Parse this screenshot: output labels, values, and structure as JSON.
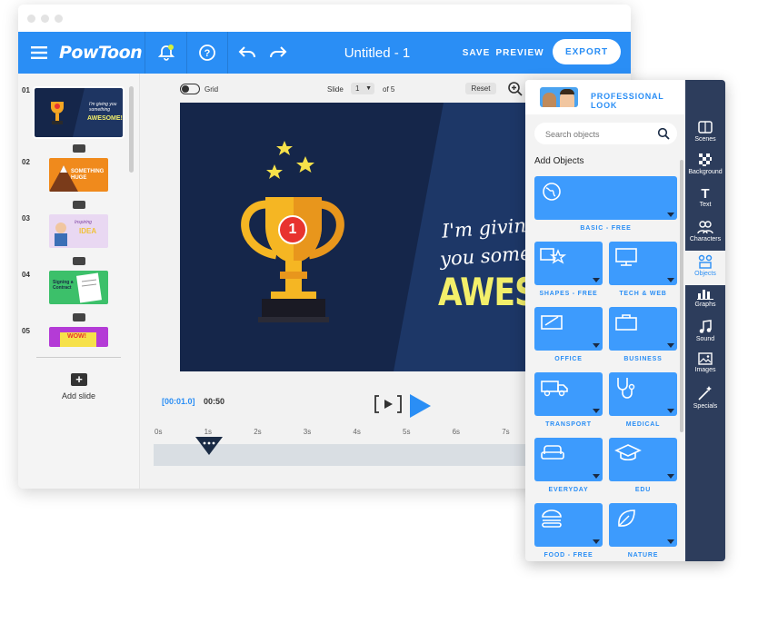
{
  "app": {
    "logo": "PowToon",
    "title": "Untitled - 1",
    "save_label": "SAVE",
    "preview_label": "PREVIEW",
    "export_label": "EXPORT"
  },
  "slides_panel": {
    "numbers": [
      "01",
      "02",
      "03",
      "04",
      "05"
    ],
    "add_slide_label": "Add slide",
    "thumb_texts": {
      "t1_small": "I'm giving you something",
      "t1_big": "AWESOME!",
      "t2": "SOMETHING HUGE",
      "t3_small": "Inspiring",
      "t3_big": "IDEA",
      "t4": "Signing a Contract",
      "t5": "WOW!"
    }
  },
  "toolbar": {
    "grid_label": "Grid",
    "slide_label": "Slide",
    "slide_value": "1",
    "of_label": "of 5",
    "reset_label": "Reset"
  },
  "slide_text": {
    "line1": "I'm giving",
    "line2": "you somethi",
    "big": "AWESO",
    "trophy_number": "1"
  },
  "timeline": {
    "current_time": "[00:01.0]",
    "duration": "00:50",
    "ticks": [
      "0s",
      "1s",
      "2s",
      "3s",
      "4s",
      "5s",
      "6s",
      "7s"
    ],
    "playhead_position_seconds": 1
  },
  "objects_panel": {
    "header": "PROFESSIONAL LOOK",
    "search_placeholder": "Search objects",
    "section_title": "Add Objects",
    "tiles": [
      "BASIC - FREE",
      "SHAPES - FREE",
      "TECH & WEB",
      "OFFICE",
      "BUSINESS",
      "TRANSPORT",
      "MEDICAL",
      "EVERYDAY",
      "EDU",
      "FOOD - FREE",
      "NATURE"
    ],
    "nav": [
      "Scenes",
      "Background",
      "Text",
      "Characters",
      "Objects",
      "Graphs",
      "Sound",
      "Images",
      "Specials"
    ],
    "active_nav": "Objects"
  },
  "colors": {
    "brand_blue": "#2a8ef5",
    "tile_blue": "#3d9bfd",
    "nav_dark": "#2d3d5c",
    "slide_bg": "#15264a",
    "accent_yellow": "#f3ef6a"
  }
}
